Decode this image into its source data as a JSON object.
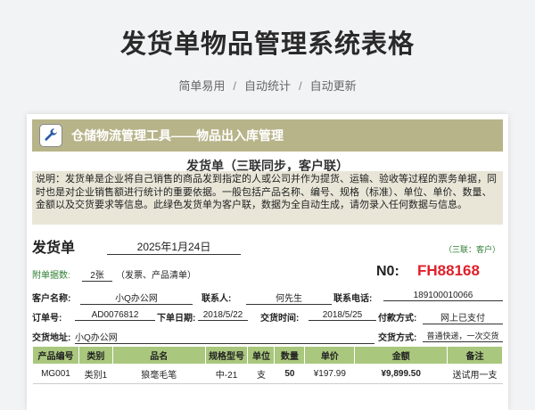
{
  "page": {
    "title": "发货单物品管理系统表格",
    "features": [
      "简单易用",
      "自动统计",
      "自动更新"
    ],
    "separator": "/"
  },
  "banner": {
    "icon": "wrench-icon",
    "title": "仓储物流管理工具——物品出入库管理"
  },
  "doc": {
    "title": "发货单（三联同步，客户联）",
    "description": "说明：发货单是企业将自己销售的商品发到指定的人或公司并作为提货、运输、验收等过程的票务单据，同时也是对企业销售额进行统计的重要依据。一般包括产品名称、编号、规格（标准）、单位、单价、数量、金额以及交货要求等信息。此绿色发货单为客户联，数据为全自动生成，请勿录入任何数据与信息。"
  },
  "form": {
    "heading": "发货单",
    "date": "2025年1月24日",
    "copy_note": "（三联：客户）",
    "attach_label": "附单据数:",
    "attach_count": "2张",
    "attach_note": "（发票、产品清单）",
    "no_label": "N0:",
    "no_value": "FH88168",
    "customer_label": "客户名称:",
    "customer": "小Q办公网",
    "contact_label": "联系人:",
    "contact": "何先生",
    "phone_label": "联系电话:",
    "phone": "189100010066",
    "order_label": "订单号:",
    "order": "AD0076812",
    "order_date_label": "下单日期:",
    "order_date": "2018/5/22",
    "delivery_time_label": "交货时间:",
    "delivery_time": "2018/5/25",
    "pay_label": "付款方式:",
    "pay": "网上已支付",
    "address_label": "交货地址:",
    "address": "小Q办公网",
    "ship_label": "交货方式:",
    "ship": "普通快递，一次交货"
  },
  "table": {
    "headers": [
      "产品编号",
      "类别",
      "品名",
      "规格型号",
      "单位",
      "数量",
      "单价",
      "金额",
      "备注"
    ],
    "rows": [
      [
        "MG001",
        "类别1",
        "狼毫毛笔",
        "中-21",
        "支",
        "50",
        "¥197.99",
        "¥9,899.50",
        "送试用一支"
      ]
    ]
  },
  "colors": {
    "banner": "#b8b48a",
    "table_header": "#a9c77d",
    "number": "#e0202a"
  }
}
